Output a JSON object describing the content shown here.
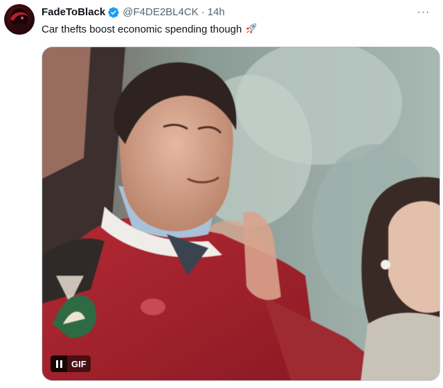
{
  "tweet": {
    "display_name": "FadeToBlack",
    "handle": "@F4DE2BL4CK",
    "separator": "·",
    "time": "14h",
    "more_label": "···",
    "text": "Car thefts boost economic spending though",
    "emoji_icon": "rocket-icon",
    "verified_icon": "verified-badge-icon",
    "verified_color": "#1d9bf0"
  },
  "media": {
    "type": "gif",
    "badge_label": "GIF",
    "pause_icon": "pause-icon"
  }
}
